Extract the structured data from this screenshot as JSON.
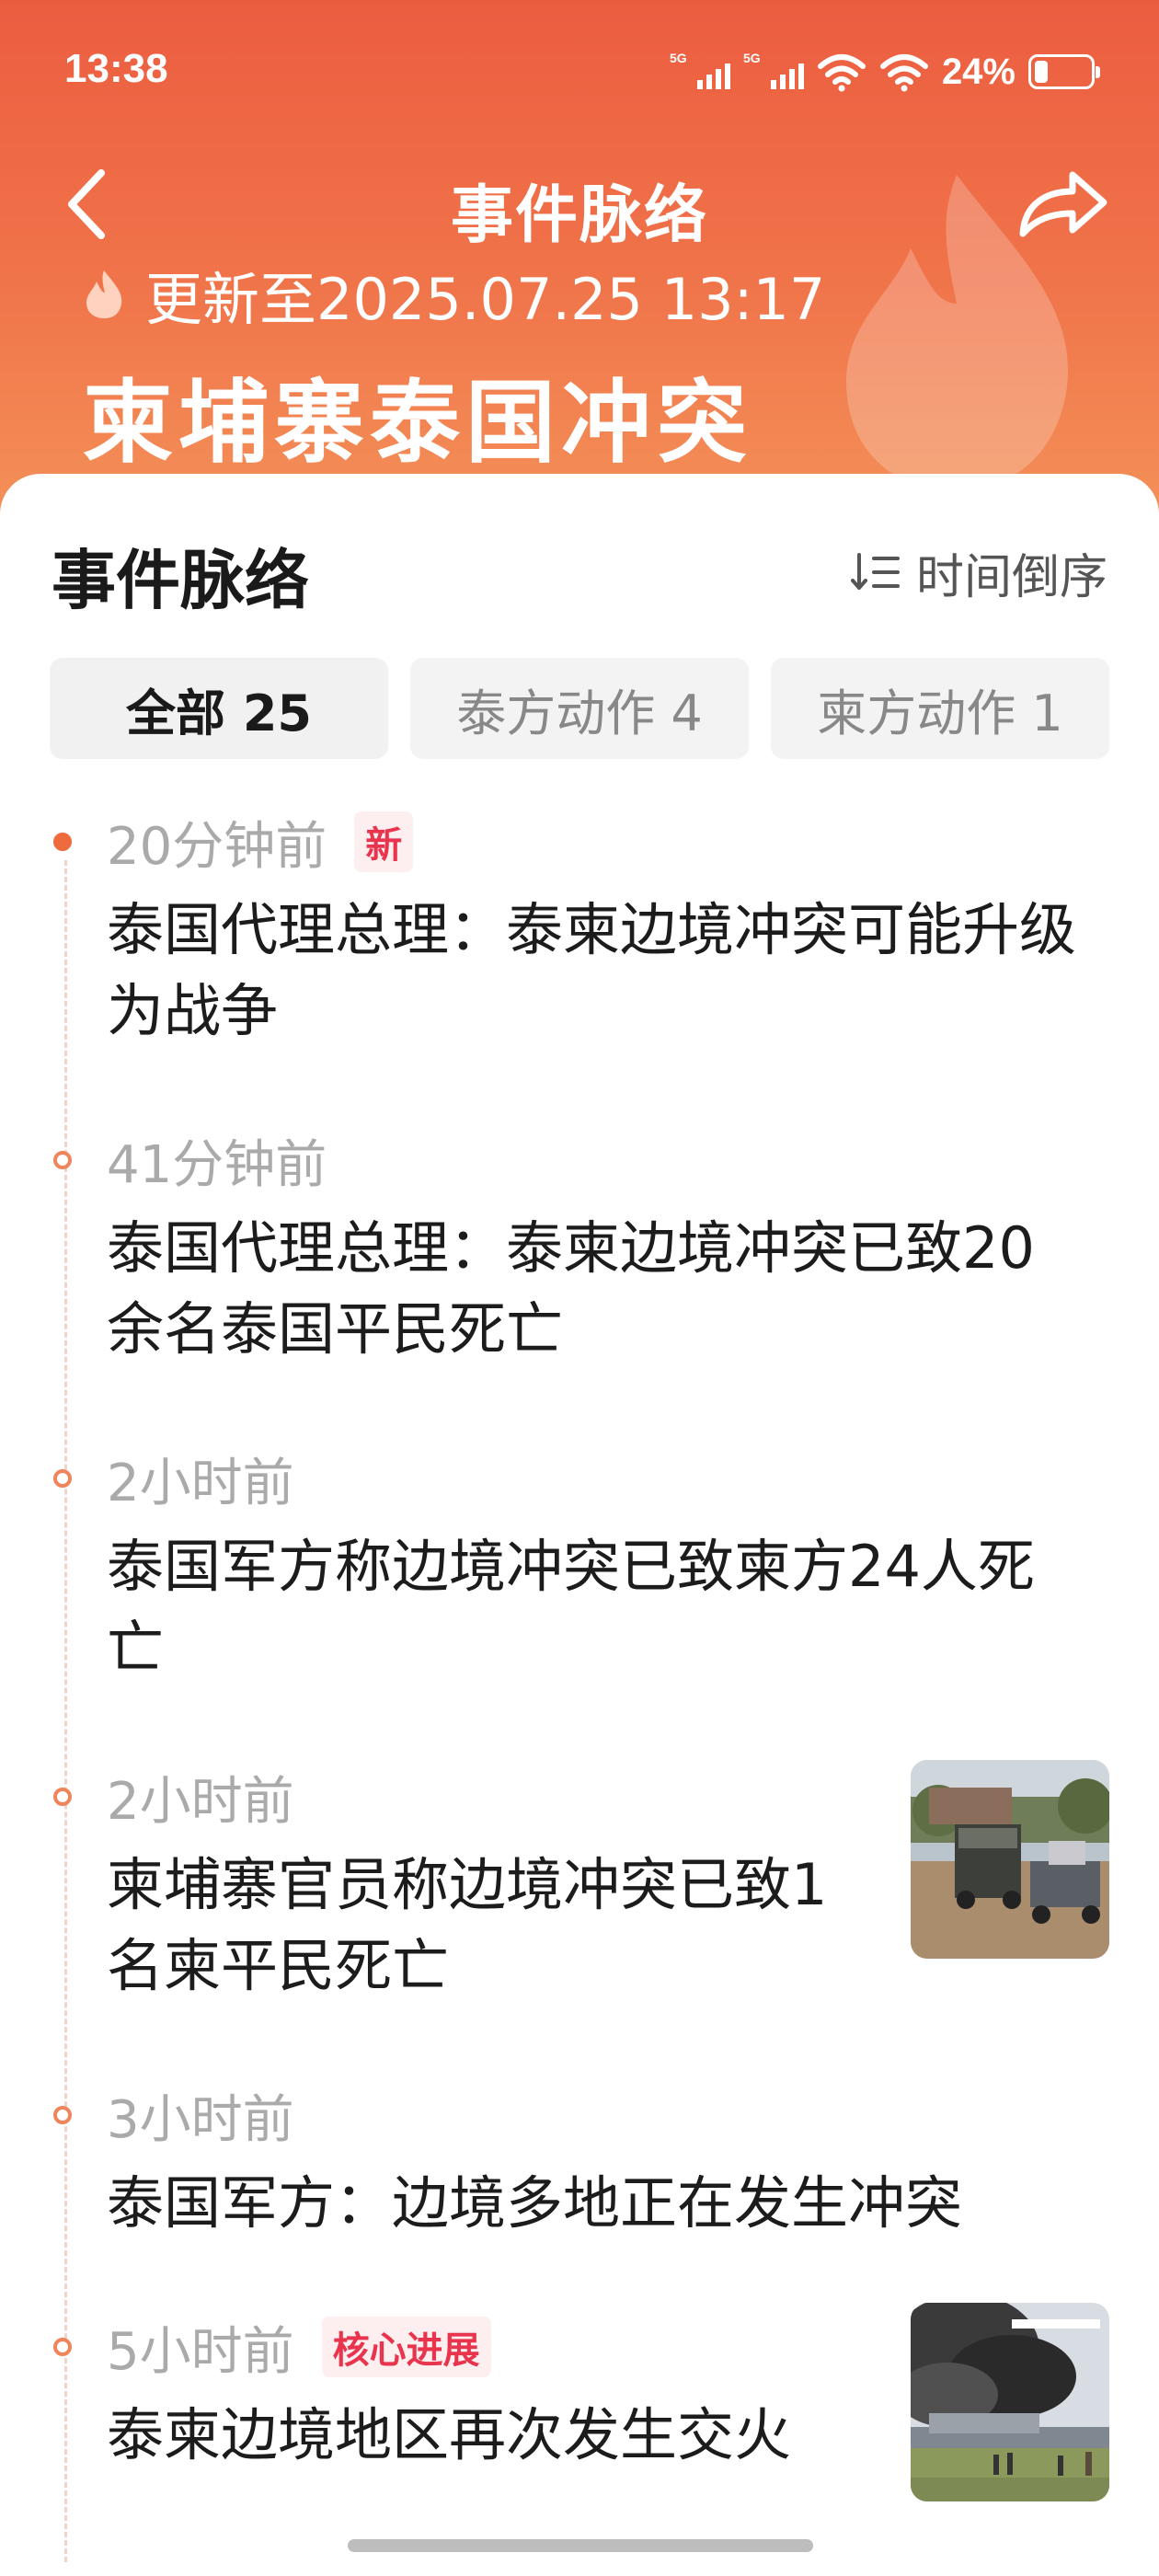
{
  "status_bar": {
    "time": "13:38",
    "signal_labels": [
      "5G",
      "5G"
    ],
    "battery_percent": "24%",
    "battery_level": 0.24
  },
  "nav": {
    "title": "事件脉络",
    "back_icon": "chevron-left-icon",
    "share_icon": "share-arrow-icon"
  },
  "header": {
    "update_text": "更新至2025.07.25 13:17",
    "topic_title": "柬埔寨泰国冲突"
  },
  "section": {
    "title": "事件脉络",
    "sort_label": "时间倒序"
  },
  "tabs": [
    {
      "label": "全部 25",
      "active": true
    },
    {
      "label": "泰方动作 4",
      "active": false
    },
    {
      "label": "柬方动作 1",
      "active": false
    }
  ],
  "timeline": [
    {
      "time": "20分钟前",
      "badge": "新",
      "headline": "泰国代理总理：泰柬边境冲突可能升级为战争"
    },
    {
      "time": "41分钟前",
      "badge": "",
      "headline": "泰国代理总理：泰柬边境冲突已致20余名泰国平民死亡"
    },
    {
      "time": "2小时前",
      "badge": "",
      "headline": "泰国军方称边境冲突已致柬方24人死亡"
    },
    {
      "time": "2小时前",
      "badge": "",
      "headline": "柬埔寨官员称边境冲突已致1名柬平民死亡"
    },
    {
      "time": "3小时前",
      "badge": "",
      "headline": "泰国军方：边境多地正在发生冲突"
    },
    {
      "time": "5小时前",
      "badge": "核心进展",
      "headline": "泰柬边境地区再次发生交火"
    }
  ],
  "colors": {
    "header_top": "#ec5d40",
    "header_bottom": "#f49058",
    "badge_text": "#e8344c",
    "badge_bg": "#fdeef0",
    "timeline_dot": "#ef6a3c"
  }
}
